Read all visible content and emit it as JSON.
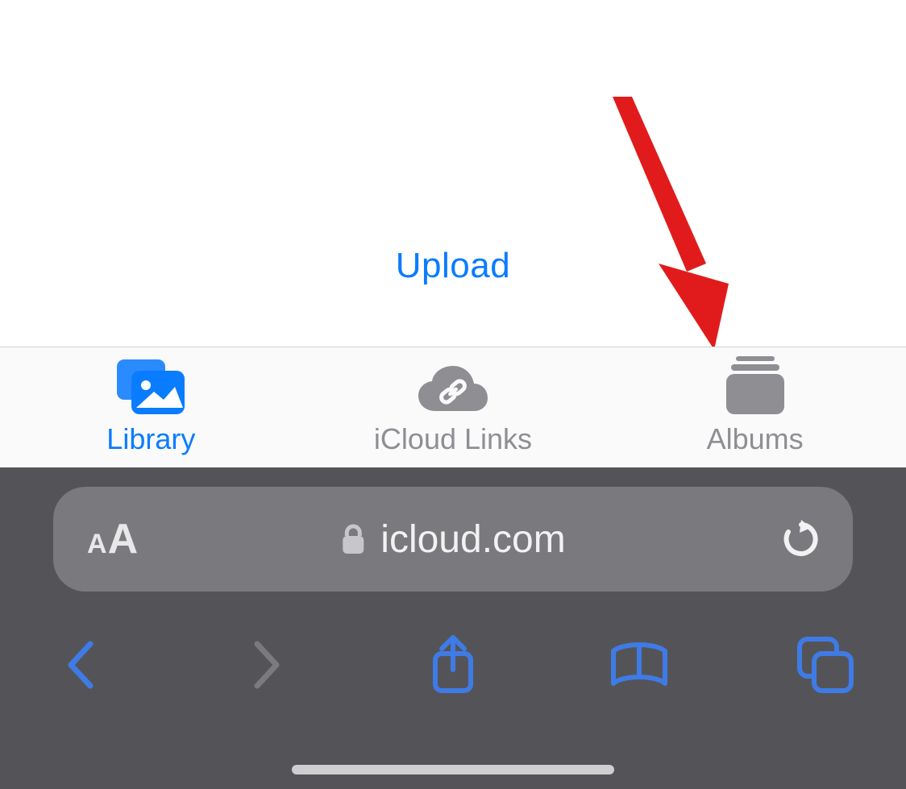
{
  "content": {
    "upload_label": "Upload"
  },
  "tabs": {
    "active_index": 0,
    "items": [
      {
        "label": "Library"
      },
      {
        "label": "iCloud Links"
      },
      {
        "label": "Albums"
      }
    ]
  },
  "safari": {
    "address_domain": "icloud.com"
  },
  "colors": {
    "accent_blue": "#0a7cff",
    "icon_gray": "#8e8e93",
    "safari_bg": "#545458",
    "addrbar_bg": "#7a7a7e",
    "arrow_red": "#e11b1b"
  },
  "annotation": {
    "arrow_target_tab_index": 2
  }
}
